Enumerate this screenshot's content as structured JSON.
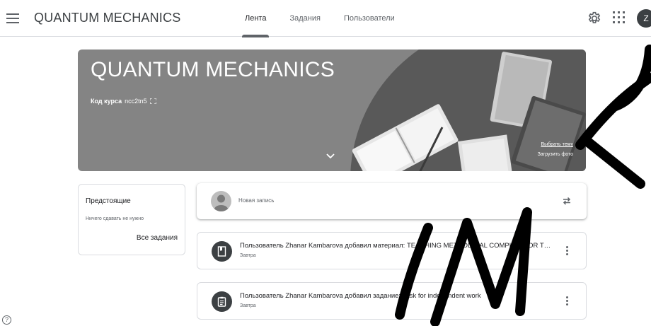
{
  "header": {
    "app_title": "QUANTUM MECHANICS",
    "tabs": [
      {
        "label": "Лента",
        "active": true
      },
      {
        "label": "Задания",
        "active": false
      },
      {
        "label": "Пользователи",
        "active": false
      }
    ],
    "avatar_letter": "Z",
    "icons": [
      "menu-icon",
      "gear-icon",
      "apps-grid-icon"
    ]
  },
  "banner": {
    "title": "QUANTUM MECHANICS",
    "code_label": "Код курса",
    "code_value": "ncc2tn5",
    "select_theme": "Выбрать тему",
    "upload_photo": "Загрузить фото"
  },
  "upcoming": {
    "title": "Предстоящие",
    "empty_text": "Ничего сдавать не нужно",
    "all_tasks": "Все задания"
  },
  "stream": {
    "new_post_placeholder": "Новая запись",
    "items": [
      {
        "icon": "material-icon",
        "text": "Пользователь Zhanar Kambarova добавил материал: TEACHING METHODICAL COMPLEX FOR THE DISCIPLINE",
        "date": "Завтра"
      },
      {
        "icon": "assignment-icon",
        "text": "Пользователь Zhanar Kambarova добавил задание: Task for independent work",
        "date": "Завтра"
      }
    ]
  },
  "help_symbol": "?",
  "colors": {
    "banner_bg": "#848484",
    "tab_indicator": "#5f6368",
    "icon_dark": "#3c4043",
    "watermark": "#000000"
  }
}
